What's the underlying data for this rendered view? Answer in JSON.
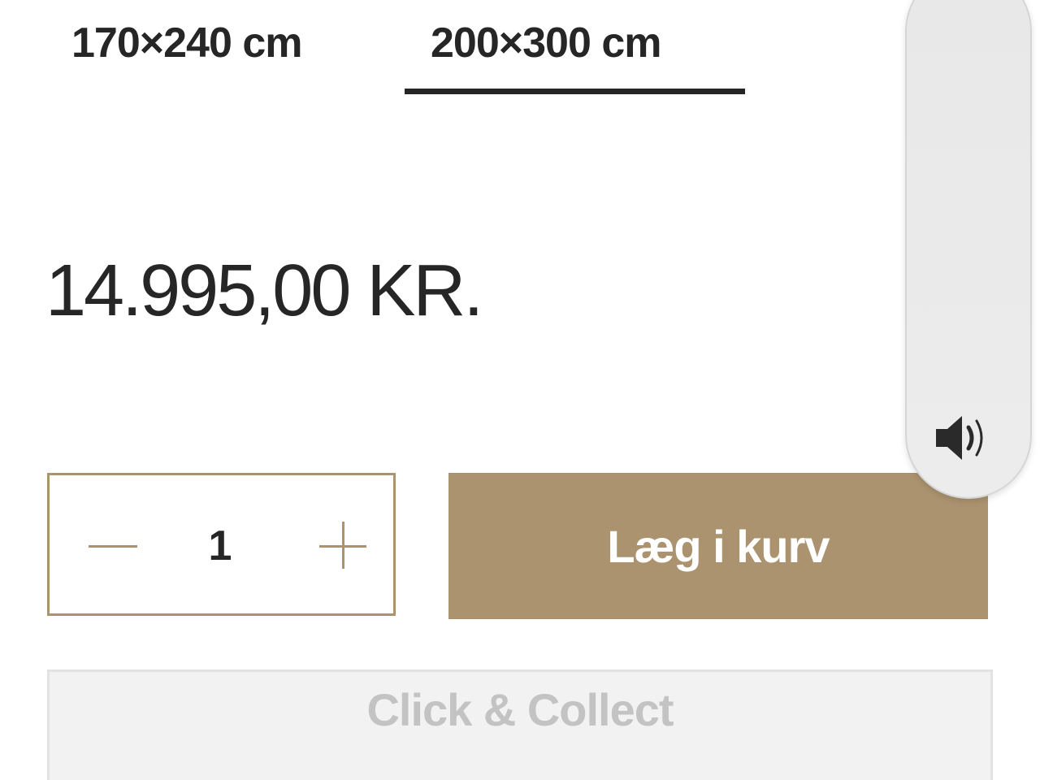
{
  "sizes": {
    "options": [
      "170×240 cm",
      "200×300 cm"
    ],
    "selected": "200×300 cm"
  },
  "price": "14.995,00 KR.",
  "quantity": {
    "value": "1",
    "decrement_icon": "minus-icon",
    "increment_icon": "plus-icon"
  },
  "actions": {
    "add_to_cart_label": "Læg i kurv",
    "click_collect_label": "Click & Collect"
  },
  "volume_panel": {
    "icon": "speaker-volume-icon"
  },
  "colors": {
    "accent": "#ab9370",
    "text": "#262626",
    "disabled_text": "#c3c3c3",
    "disabled_bg": "#f2f2f2"
  }
}
